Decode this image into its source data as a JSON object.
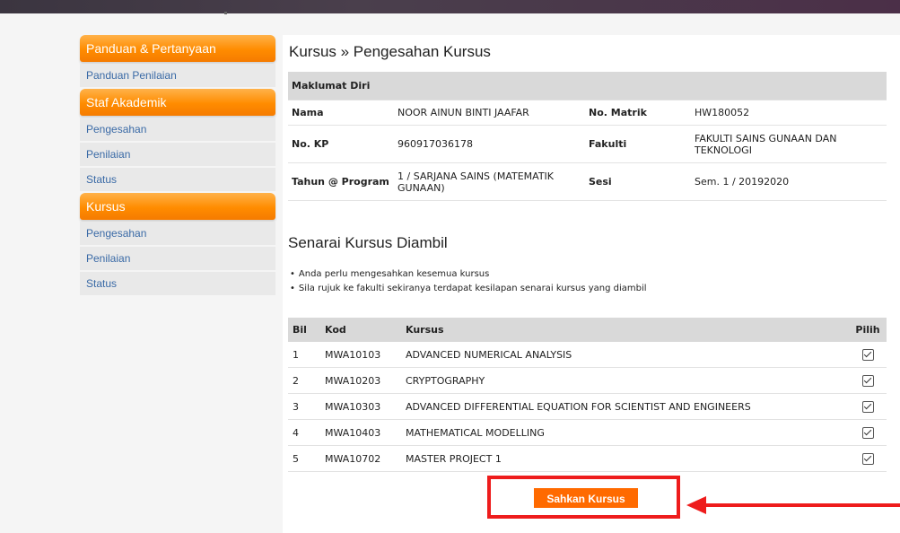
{
  "sidebar": {
    "sections": [
      {
        "title": "Panduan & Pertanyaan",
        "items": [
          "Panduan Penilaian"
        ]
      },
      {
        "title": "Staf Akademik",
        "items": [
          "Pengesahan",
          "Penilaian",
          "Status"
        ]
      },
      {
        "title": "Kursus",
        "items": [
          "Pengesahan",
          "Penilaian",
          "Status"
        ]
      }
    ]
  },
  "main": {
    "title": "Kursus » Pengesahan Kursus",
    "info": {
      "section_label": "Maklumat Diri",
      "nama_label": "Nama",
      "nama_value": "NOOR AINUN BINTI JAAFAR",
      "matrik_label": "No. Matrik",
      "matrik_value": "HW180052",
      "kp_label": "No. KP",
      "kp_value": "960917036178",
      "fakulti_label": "Fakulti",
      "fakulti_value": "FAKULTI SAINS GUNAAN DAN TEKNOLOGI",
      "program_label": "Tahun @ Program",
      "program_value": "1 / SARJANA SAINS (MATEMATIK GUNAAN)",
      "sesi_label": "Sesi",
      "sesi_value": "Sem. 1 / 20192020"
    },
    "courses_title": "Senarai Kursus Diambil",
    "notes": [
      "Anda perlu mengesahkan kesemua kursus",
      "Sila rujuk ke fakulti sekiranya terdapat kesilapan senarai kursus yang diambil"
    ],
    "table": {
      "headers": {
        "bil": "Bil",
        "kod": "Kod",
        "kursus": "Kursus",
        "pilih": "Pilih"
      },
      "rows": [
        {
          "bil": "1",
          "kod": "MWA10103",
          "kursus": "ADVANCED NUMERICAL ANALYSIS",
          "checked": true
        },
        {
          "bil": "2",
          "kod": "MWA10203",
          "kursus": "CRYPTOGRAPHY",
          "checked": true
        },
        {
          "bil": "3",
          "kod": "MWA10303",
          "kursus": "ADVANCED DIFFERENTIAL EQUATION FOR SCIENTIST AND ENGINEERS",
          "checked": true
        },
        {
          "bil": "4",
          "kod": "MWA10403",
          "kursus": "MATHEMATICAL MODELLING",
          "checked": true
        },
        {
          "bil": "5",
          "kod": "MWA10702",
          "kursus": "MASTER PROJECT 1",
          "checked": true
        }
      ]
    },
    "submit_label": "Sahkan Kursus"
  },
  "colors": {
    "accent": "#ff8c00",
    "button": "#ff6a00",
    "highlight": "#ee1c1c",
    "link": "#3a6aa6"
  }
}
